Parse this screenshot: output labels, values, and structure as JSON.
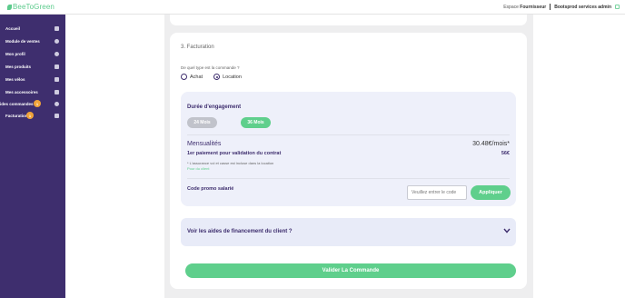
{
  "header": {
    "logo_text": "BeeToGreen",
    "espace_label": "Espace",
    "espace_value": "Fournisseur",
    "account_name": "Bootsprod services admin"
  },
  "sidebar": {
    "items": [
      {
        "label": "Accueil",
        "icon": "home-icon"
      },
      {
        "label": "Module de ventes",
        "icon": "search-icon"
      },
      {
        "label": "Mon profil",
        "icon": "user-icon"
      },
      {
        "label": "Mes produits",
        "icon": "box-icon"
      },
      {
        "label": "Mes vélos",
        "icon": "box-icon"
      },
      {
        "label": "Mes accessoires",
        "icon": "box-icon"
      },
      {
        "label": "ides commandes",
        "icon": "gear-icon",
        "badge": "1"
      },
      {
        "label": "Facturation",
        "icon": "card-icon",
        "badge": "1"
      }
    ]
  },
  "billing": {
    "section_title": "3. Facturation",
    "question": "De quel type est la commande ?",
    "options": [
      "Achat",
      "Location"
    ],
    "selected_option": "Location",
    "engagement_title": "Durée d'engagement",
    "durations": [
      "24 Mois",
      "36 Mois"
    ],
    "selected_duration": "36 Mois",
    "monthly_label": "Mensualités",
    "monthly_value": "30.48€/mois*",
    "first_payment_label": "1er paiement pour validation du contrat",
    "first_payment_value": "56€",
    "insurance_note": "* L'assurance vol et casse est incluse dans la location",
    "client_link": "Pour du client",
    "promo_label": "Code promo salarié",
    "promo_placeholder": "Veuillez entrer le code",
    "apply_label": "Appliquer",
    "aid_label": "Voir les aides de financement du client ?",
    "validate_label": "Valider La Commande"
  },
  "colors": {
    "sidebar": "#3e2e6e",
    "accent_green": "#5fcf8c",
    "badge_orange": "#f0a33a"
  }
}
